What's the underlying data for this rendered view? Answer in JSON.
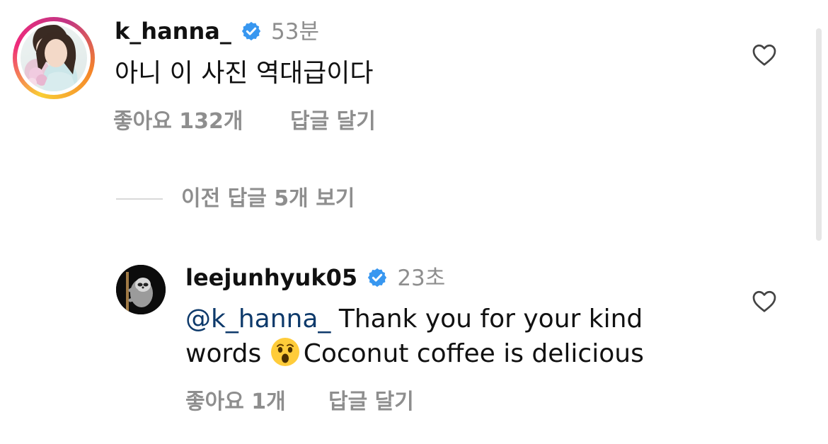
{
  "comments": [
    {
      "username": "k_hanna_",
      "time": "53분",
      "text": "아니 이 사진 역대급이다",
      "likes": "좋아요 132개",
      "reply": "답글 달기",
      "verified": true
    }
  ],
  "thread": {
    "view_more": "이전 답글 5개 보기"
  },
  "replies": [
    {
      "username": "leejunhyuk05",
      "time": "23초",
      "mention": "@k_hanna_",
      "text_line1": " Thank you for your kind",
      "text_line2_before": "words ",
      "emoji": "astonished-face-emoji",
      "text_line2_after": "Coconut coffee is delicious",
      "likes": "좋아요 1개",
      "reply": "답글 달기",
      "verified": true
    }
  ],
  "colors": {
    "verified": "#3897f0",
    "meta_text": "#8e8e8e",
    "mention": "#0e3a6b"
  }
}
